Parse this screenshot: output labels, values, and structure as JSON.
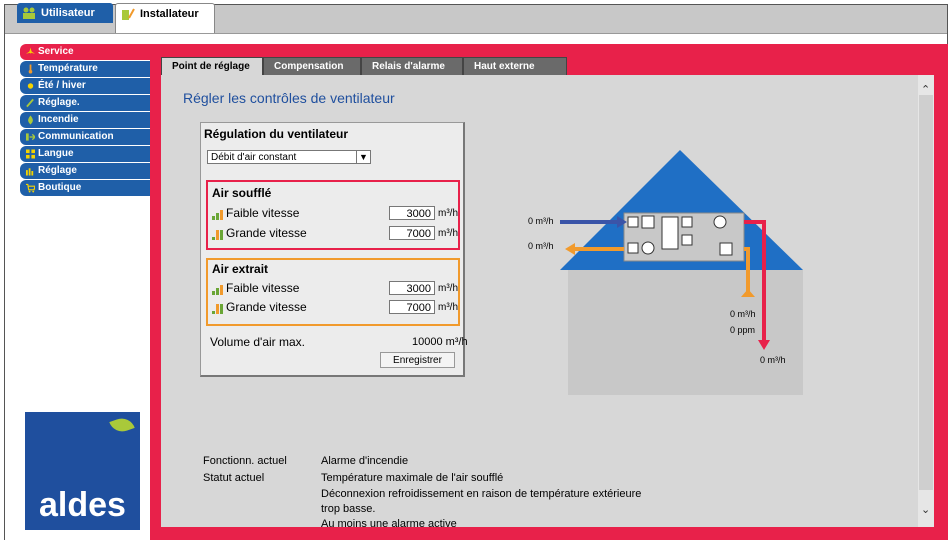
{
  "top_tabs": [
    {
      "label": "Utilisateur"
    },
    {
      "label": "Installateur"
    }
  ],
  "sidebar": {
    "items": [
      {
        "label": "Service"
      },
      {
        "label": "Température"
      },
      {
        "label": "Été / hiver"
      },
      {
        "label": "Réglage."
      },
      {
        "label": "Incendie"
      },
      {
        "label": "Communication"
      },
      {
        "label": "Langue"
      },
      {
        "label": "Réglage"
      },
      {
        "label": "Boutique"
      }
    ]
  },
  "logo": {
    "text": "aldes"
  },
  "subtabs": [
    {
      "label": "Point de réglage"
    },
    {
      "label": "Compensation"
    },
    {
      "label": "Relais d'alarme"
    },
    {
      "label": "Haut externe"
    }
  ],
  "page": {
    "heading": "Régler les contrôles de ventilateur"
  },
  "regulation": {
    "title": "Régulation du ventilateur",
    "mode": "Débit d'air constant",
    "supply": {
      "title": "Air soufflé",
      "low_label": "Faible vitesse",
      "low_value": "3000",
      "high_label": "Grande vitesse",
      "high_value": "7000",
      "unit": "m³/h"
    },
    "extract": {
      "title": "Air extrait",
      "low_label": "Faible vitesse",
      "low_value": "3000",
      "high_label": "Grande vitesse",
      "high_value": "7000",
      "unit": "m³/h"
    },
    "max_label": "Volume d'air max.",
    "max_value": "10000 m³/h",
    "save_label": "Enregistrer"
  },
  "diagram": {
    "supply_in": "0 m³/h",
    "extract_out": "0 m³/h",
    "room_extract_flow": "0 m³/h",
    "room_ppm": "0 ppm",
    "room_supply_flow": "0 m³/h",
    "colors": {
      "roof": "#1f6fc5",
      "building": "#c8c8c8",
      "supply": "#e8214a",
      "extract": "#f19a2c",
      "fresh": "#3a54a8"
    }
  },
  "status": {
    "op_label": "Fonctionn. actuel",
    "op_value": "Alarme d'incendie",
    "state_label": "Statut actuel",
    "lines": [
      "Température maximale de l'air soufflé",
      "Déconnexion refroidissement en raison de température extérieure",
      "trop basse.",
      "Au moins une alarme active"
    ]
  }
}
